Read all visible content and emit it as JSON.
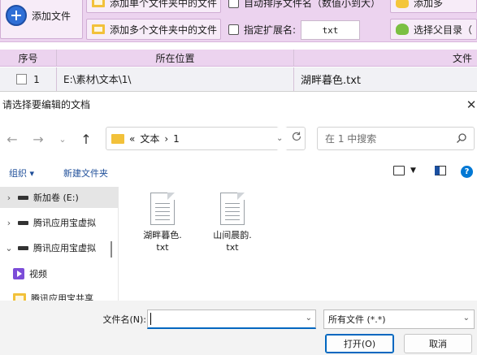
{
  "app": {
    "add_file": "添加文件",
    "btn_single_folder": "添加单个文件夹中的文件",
    "chk_auto_sort": "自动排序文件名（数值小到大）",
    "btn_multi_folder": "添加多个文件夹中的文件",
    "chk_ext": "指定扩展名:",
    "ext_value": "txt",
    "btn_add_more": "添加多",
    "btn_select_parent": "选择父目录（",
    "grid": {
      "headers": [
        "序号",
        "所在位置",
        "文件"
      ],
      "rows": [
        {
          "index": "1",
          "location": "E:\\素材\\文本\\1\\",
          "file": "湖畔暮色.txt"
        }
      ]
    }
  },
  "dialog": {
    "title": "请选择要编辑的文档",
    "address": {
      "prefix": "«",
      "path1": "文本",
      "sep": "›",
      "path2": "1"
    },
    "search_placeholder": "在 1 中搜索",
    "organize": "组织 ▾",
    "new_folder": "新建文件夹",
    "tree": [
      {
        "arrow": "›",
        "label": "新加卷 (E:)"
      },
      {
        "arrow": "›",
        "label": "腾讯应用宝虚拟"
      },
      {
        "arrow": "⌄",
        "label": "腾讯应用宝虚拟"
      },
      {
        "arrow": "",
        "label": "视频"
      },
      {
        "arrow": "",
        "label": "腾讯应用宝共享"
      }
    ],
    "files": [
      {
        "name": "湖畔暮色.\ntxt"
      },
      {
        "name": "山间晨韵.\ntxt"
      }
    ],
    "filename_label": "文件名(N):",
    "filename_value": "",
    "filter_value": "所有文件 (*.*)",
    "open_label": "打开(O)",
    "cancel_label": "取消"
  }
}
